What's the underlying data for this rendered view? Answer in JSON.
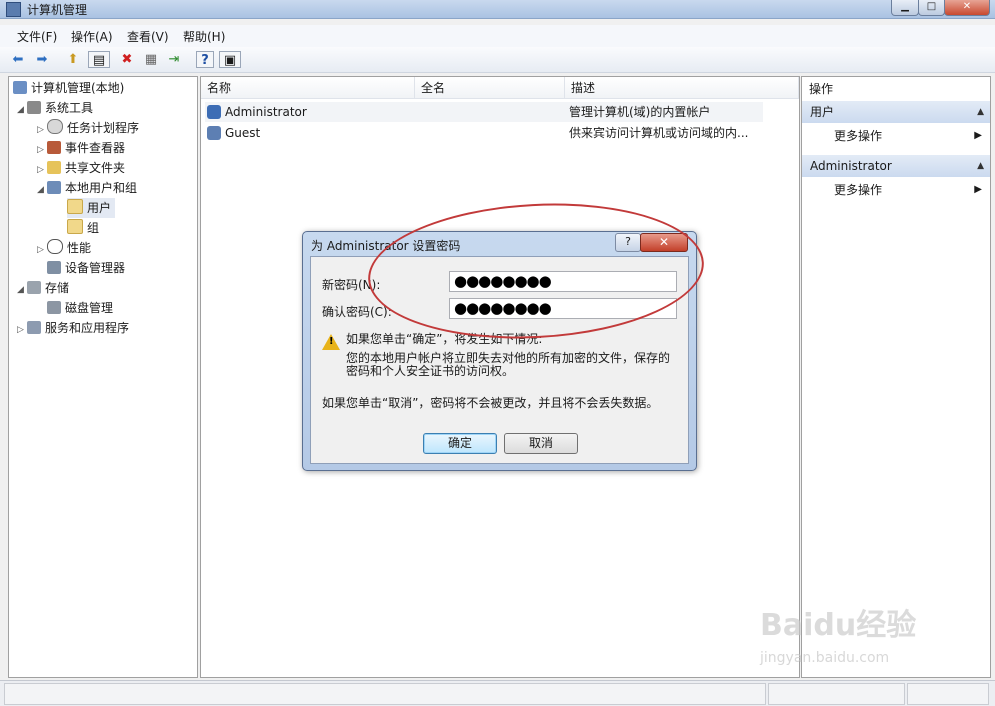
{
  "window": {
    "title": "计算机管理"
  },
  "menu": [
    "文件(F)",
    "操作(A)",
    "查看(V)",
    "帮助(H)"
  ],
  "toolbar_icons": [
    "back-icon",
    "forward-icon",
    "up-icon",
    "show-hide-tree-icon",
    "delete-icon",
    "properties-icon",
    "export-icon",
    "help-icon",
    "view-icon"
  ],
  "tree": {
    "root": "计算机管理(本地)",
    "system_tools": "系统工具",
    "task_scheduler": "任务计划程序",
    "event_viewer": "事件查看器",
    "shared_folders": "共享文件夹",
    "local_users": "本地用户和组",
    "users": "用户",
    "groups": "组",
    "performance": "性能",
    "device_manager": "设备管理器",
    "storage": "存储",
    "disk_management": "磁盘管理",
    "services": "服务和应用程序"
  },
  "list": {
    "columns": [
      "名称",
      "全名",
      "描述"
    ],
    "rows": [
      {
        "name": "Administrator",
        "fullname": "",
        "description": "管理计算机(域)的内置帐户"
      },
      {
        "name": "Guest",
        "fullname": "",
        "description": "供来宾访问计算机或访问域的内..."
      }
    ]
  },
  "actions": {
    "header": "操作",
    "section1": "用户",
    "section1_more": "更多操作",
    "section2": "Administrator",
    "section2_more": "更多操作"
  },
  "dialog": {
    "title": "为 Administrator 设置密码",
    "help": "?",
    "close": "✕",
    "new_password_label": "新密码(N):",
    "new_password_value": "●●●●●●●●",
    "confirm_password_label": "确认密码(C):",
    "confirm_password_value": "●●●●●●●●",
    "warning_line1": "如果您单击“确定”，将发生如下情况:",
    "warning_line2": "您的本地用户帐户将立即失去对他的所有加密的文件，保存的",
    "warning_line3": "密码和个人安全证书的访问权。",
    "cancel_note": "如果您单击“取消”，密码将不会被更改，并且将不会丢失数据。",
    "ok": "确定",
    "cancel": "取消"
  },
  "watermark": {
    "brand": "Baidu经验",
    "url": "jingyan.baidu.com"
  },
  "colors": {
    "annotation": "#c23a3a",
    "selection": "#e3e9f3",
    "dialog_frame": "#b4c9e6"
  }
}
